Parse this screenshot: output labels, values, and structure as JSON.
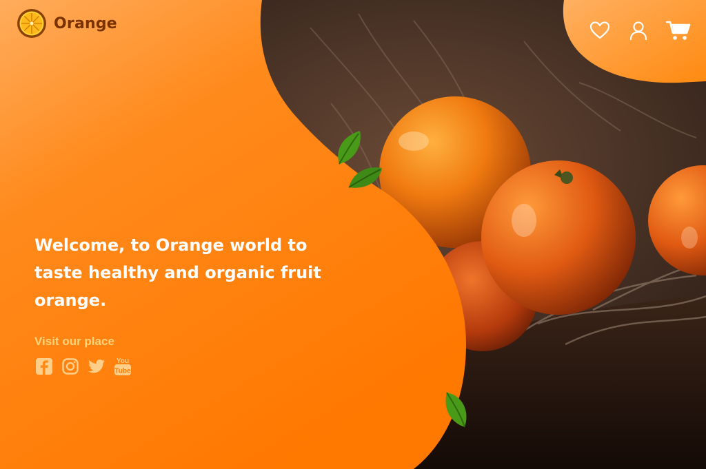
{
  "brand": {
    "name": "Orange",
    "logo_icon": "orange-slice-icon"
  },
  "nav": {
    "icons": [
      "heart-icon",
      "user-icon",
      "cart-icon"
    ]
  },
  "hero": {
    "headline": "Welcome, to Orange world to taste healthy and organic fruit orange.",
    "visit_label": "Visit our place"
  },
  "social": {
    "icons": [
      "facebook-icon",
      "instagram-icon",
      "twitter-icon",
      "youtube-icon"
    ],
    "youtube_text_top": "You",
    "youtube_text_bottom": "Tube"
  },
  "colors": {
    "orange_primary": "#ff7a00",
    "orange_light": "#ffa64a",
    "brand_text": "#7a3200",
    "visit_text": "#ffd47a",
    "leaf_green": "#4a9a1a"
  }
}
